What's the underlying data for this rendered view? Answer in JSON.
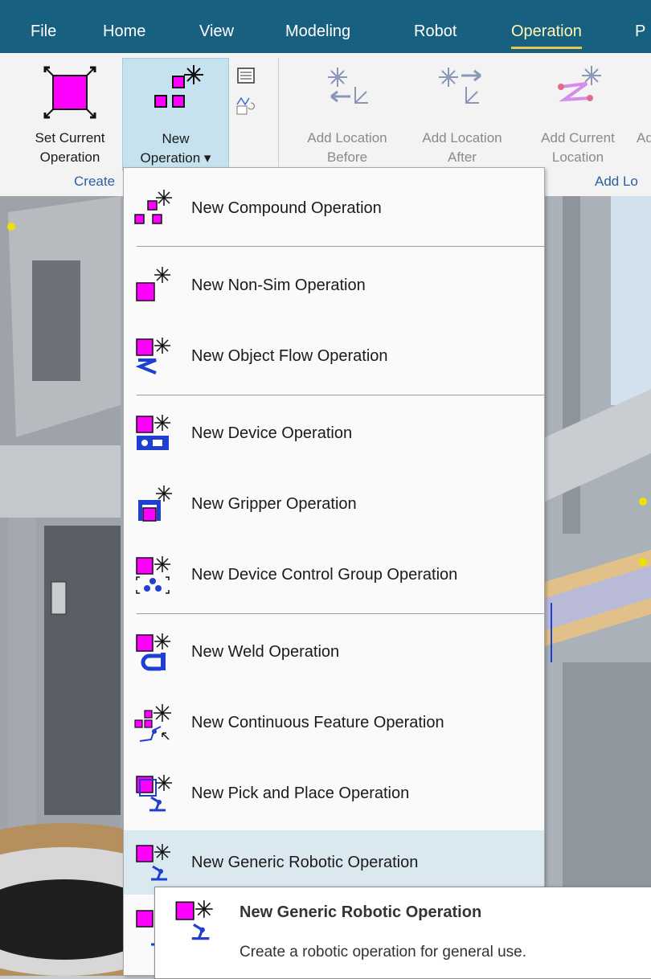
{
  "menubar": {
    "tabs": [
      {
        "label": "File"
      },
      {
        "label": "Home"
      },
      {
        "label": "View"
      },
      {
        "label": "Modeling"
      },
      {
        "label": "Robot"
      },
      {
        "label": "Operation",
        "active": true
      },
      {
        "label": "P"
      }
    ]
  },
  "ribbon": {
    "set_current": {
      "line1": "Set Current",
      "line2": "Operation"
    },
    "new_operation": {
      "line1": "New",
      "line2": "Operation ▾"
    },
    "group_create": "Create",
    "add_before": {
      "line1": "Add Location",
      "line2": "Before"
    },
    "add_after": {
      "line1": "Add Location",
      "line2": "After"
    },
    "add_current": {
      "line1": "Add Current",
      "line2": "Location"
    },
    "add_cut": "Ad",
    "group_add": "Add Lo"
  },
  "dropdown": {
    "items": [
      {
        "label": "New Compound Operation",
        "icon": "compound-operation-icon"
      },
      {
        "label": "New Non-Sim Operation",
        "icon": "non-sim-operation-icon"
      },
      {
        "label": "New Object Flow Operation",
        "icon": "object-flow-operation-icon"
      },
      {
        "label": "New Device Operation",
        "icon": "device-operation-icon"
      },
      {
        "label": "New Gripper Operation",
        "icon": "gripper-operation-icon"
      },
      {
        "label": "New Device Control Group Operation",
        "icon": "device-control-group-icon"
      },
      {
        "label": "New Weld Operation",
        "icon": "weld-operation-icon"
      },
      {
        "label": "New Continuous Feature Operation",
        "icon": "continuous-feature-icon"
      },
      {
        "label": "New Pick and Place Operation",
        "icon": "pick-and-place-icon"
      },
      {
        "label": "New Generic Robotic Operation",
        "icon": "generic-robotic-icon",
        "highlighted": true
      }
    ]
  },
  "tooltip": {
    "title": "New Generic Robotic Operation",
    "description": "Create a robotic operation for general use."
  },
  "colors": {
    "titlebar": "#17607f",
    "accent_underline": "#e8c84a",
    "magenta": "#ff00ff",
    "cyan_star": "#00b4c8",
    "blue": "#1f3fd0",
    "highlight": "#dae9ef",
    "ribbon_selected": "#c5e2ee"
  }
}
